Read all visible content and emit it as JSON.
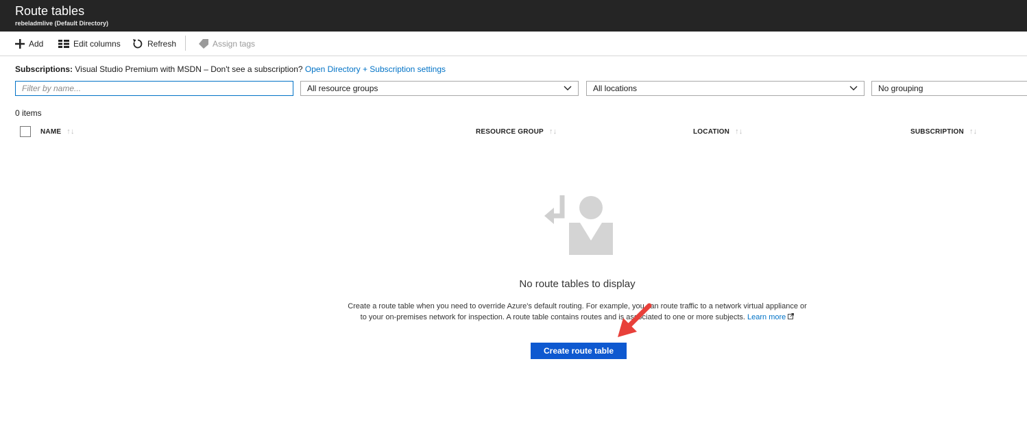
{
  "header": {
    "title": "Route tables",
    "subtitle": "rebeladmlive (Default Directory)"
  },
  "toolbar": {
    "add_label": "Add",
    "edit_columns_label": "Edit columns",
    "refresh_label": "Refresh",
    "assign_tags_label": "Assign tags"
  },
  "subscriptions": {
    "label": "Subscriptions:",
    "text": "Visual Studio Premium with MSDN – Don't see a subscription?",
    "link": "Open Directory + Subscription settings"
  },
  "filters": {
    "name_placeholder": "Filter by name...",
    "resource_groups": "All resource groups",
    "locations": "All locations",
    "grouping": "No grouping"
  },
  "list": {
    "count": "0 items",
    "columns": [
      "NAME",
      "RESOURCE GROUP",
      "LOCATION",
      "SUBSCRIPTION"
    ]
  },
  "empty_state": {
    "title": "No route tables to display",
    "description": "Create a route table when you need to override Azure's default routing. For example, you can route traffic to a network virtual appliance or to your on-premises network for inspection. A route table contains routes and is associated to one or more subjects.",
    "learn_more": "Learn more",
    "button": "Create route table"
  },
  "colors": {
    "header_bg": "#252525",
    "link": "#0072c6",
    "button": "#0e59d0",
    "annotation_arrow": "#e8403a"
  },
  "icons": [
    "plus-icon",
    "columns-icon",
    "refresh-icon",
    "tag-icon",
    "chevron-down-icon",
    "sort-icon",
    "external-link-icon",
    "empty-route-icon",
    "annotation-arrow"
  ]
}
